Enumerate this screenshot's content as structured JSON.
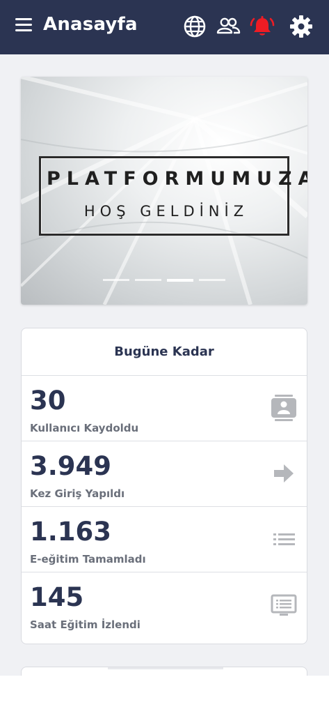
{
  "header": {
    "title": "Anasayfa",
    "icons": [
      "menu-icon",
      "globe-icon",
      "users-icon",
      "alarm-bell-icon",
      "gear-icon"
    ],
    "alert_color": "#ee1c24",
    "background": "#2b3452"
  },
  "banner": {
    "line1": "PLATFORMUMUZA",
    "line2": "HOŞ GELDİNİZ",
    "slides_total": 4,
    "active_slide": 3
  },
  "stats": {
    "title": "Bugüne Kadar",
    "items": [
      {
        "value": "30",
        "label": "Kullanıcı Kaydoldu",
        "icon": "contact-card-icon"
      },
      {
        "value": "3.949",
        "label": "Kez Giriş Yapıldı",
        "icon": "arrow-right-icon"
      },
      {
        "value": "1.163",
        "label": "E-eğitim Tamamladı",
        "icon": "list-icon"
      },
      {
        "value": "145",
        "label": "Saat Eğitim İzlendi",
        "icon": "monitor-icon"
      }
    ]
  }
}
